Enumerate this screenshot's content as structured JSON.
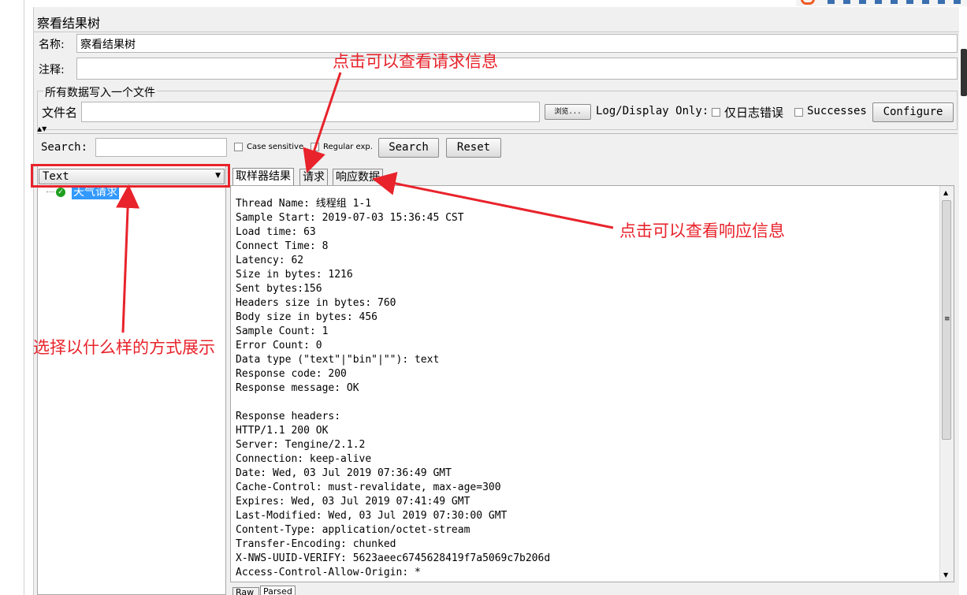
{
  "window": {
    "title": "察看结果树"
  },
  "form": {
    "name_label": "名称:",
    "name_value": "察看结果树",
    "comment_label": "注释:",
    "comment_value": ""
  },
  "file_group": {
    "legend": "所有数据写入一个文件",
    "filename_label": "文件名",
    "filename_value": "",
    "browse_label": "浏览...",
    "log_display_label": "Log/Display Only:",
    "errors_only_label": "仅日志错误",
    "successes_label": "Successes",
    "configure_label": "Configure"
  },
  "search": {
    "label": "Search:",
    "value": "",
    "case_sensitive_label": "Case sensitive",
    "regular_exp_label": "Regular exp.",
    "search_button": "Search",
    "reset_button": "Reset"
  },
  "renderer_select": {
    "selected": "Text"
  },
  "tree": {
    "items": [
      {
        "label": "天气请求",
        "status_icon": "check-shield-icon",
        "status_color": "#1ea01e"
      }
    ]
  },
  "tabs": [
    {
      "label": "取样器结果",
      "active": true
    },
    {
      "label": "请求",
      "active": false
    },
    {
      "label": "响应数据",
      "active": false
    }
  ],
  "response_lines": [
    "Thread Name: 线程组 1-1",
    "Sample Start: 2019-07-03 15:36:45 CST",
    "Load time: 63",
    "Connect Time: 8",
    "Latency: 62",
    "Size in bytes: 1216",
    "Sent bytes:156",
    "Headers size in bytes: 760",
    "Body size in bytes: 456",
    "Sample Count: 1",
    "Error Count: 0",
    "Data type (\"text\"|\"bin\"|\"\"): text",
    "Response code: 200",
    "Response message: OK",
    "",
    "Response headers:",
    "HTTP/1.1 200 OK",
    "Server: Tengine/2.1.2",
    "Connection: keep-alive",
    "Date: Wed, 03 Jul 2019 07:36:49 GMT",
    "Cache-Control: must-revalidate, max-age=300",
    "Expires: Wed, 03 Jul 2019 07:41:49 GMT",
    "Last-Modified: Wed, 03 Jul 2019 07:30:00 GMT",
    "Content-Type: application/octet-stream",
    "Transfer-Encoding: chunked",
    "X-NWS-UUID-VERIFY: 5623aeec6745628419f7a5069c7b206d",
    "Access-Control-Allow-Origin: *"
  ],
  "bottom_tabs": [
    {
      "label": "Raw"
    },
    {
      "label": "Parsed"
    }
  ],
  "annotations": {
    "request_hint": "点击可以查看请求信息",
    "response_hint": "点击可以查看响应信息",
    "display_hint": "选择以什么样的方式展示",
    "color": "#e8232b"
  }
}
